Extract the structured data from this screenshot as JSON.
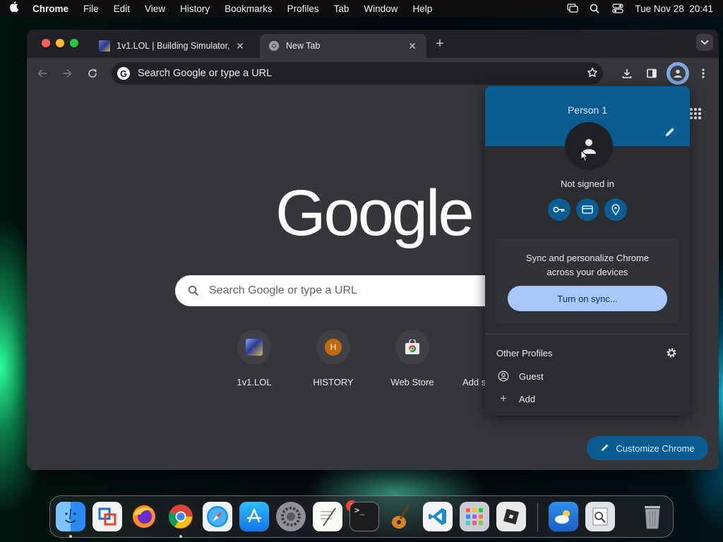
{
  "menubar": {
    "app_name": "Chrome",
    "menus": [
      "File",
      "Edit",
      "View",
      "History",
      "Bookmarks",
      "Profiles",
      "Tab",
      "Window",
      "Help"
    ],
    "datetime": "Tue Nov 28  20:41"
  },
  "tabs": [
    {
      "title": "1v1.LOL | Building Simulator,",
      "active": false,
      "favicon": "1v1lol-favicon"
    },
    {
      "title": "New Tab",
      "active": true,
      "favicon": "chrome-favicon"
    }
  ],
  "toolbar": {
    "omnibox_placeholder": "Search Google or type a URL"
  },
  "ntp": {
    "logo_text": "Google",
    "search_placeholder": "Search Google or type a URL",
    "shortcuts": [
      {
        "label": "1v1.LOL",
        "icon": "1v1lol-icon"
      },
      {
        "label": "HISTORY",
        "icon": "letter-h-icon",
        "letter": "H"
      },
      {
        "label": "Web Store",
        "icon": "webstore-icon"
      },
      {
        "label": "Add s",
        "icon": "add-shortcut-icon"
      }
    ],
    "customize_label": "Customize Chrome"
  },
  "profile_popup": {
    "name": "Person 1",
    "status": "Not signed in",
    "quick_actions": [
      "key-icon",
      "credit-card-icon",
      "location-pin-icon"
    ],
    "sync_text_line1": "Sync and personalize Chrome",
    "sync_text_line2": "across your devices",
    "sync_button": "Turn on sync...",
    "other_profiles_label": "Other Profiles",
    "guest_label": "Guest",
    "add_label": "Add"
  },
  "dock": {
    "apps": [
      "finder",
      "vmware-fusion",
      "firefox",
      "chrome",
      "safari",
      "app-store",
      "system-settings",
      "textedit",
      "terminal",
      "garageband",
      "vscode",
      "launchpad",
      "roblox",
      "weather",
      "preview",
      "trash"
    ],
    "settings_badge": "2"
  },
  "colors": {
    "popup_header": "#0b5c91",
    "sync_button": "#a8c7fa",
    "window_bg": "#35363a",
    "tabstrip": "#202124"
  }
}
